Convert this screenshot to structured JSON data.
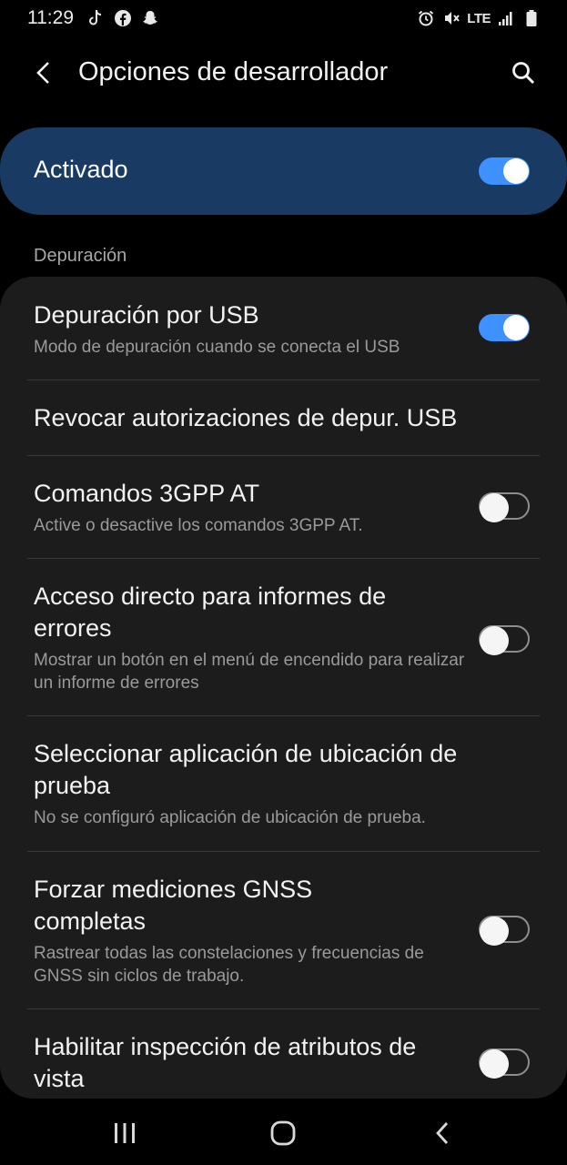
{
  "status_bar": {
    "time": "11:29",
    "network": "LTE",
    "left_icons": [
      "tiktok-icon",
      "facebook-icon",
      "snapchat-icon"
    ],
    "right_icons": [
      "alarm-icon",
      "mute-icon",
      "signal-icon",
      "battery-icon"
    ]
  },
  "header": {
    "title": "Opciones de desarrollador"
  },
  "master": {
    "label": "Activado",
    "enabled": true
  },
  "section": {
    "title": "Depuración"
  },
  "items": [
    {
      "title": "Depuración por USB",
      "subtitle": "Modo de depuración cuando se conecta el USB",
      "toggle": true
    },
    {
      "title": "Revocar autorizaciones de depur. USB"
    },
    {
      "title": "Comandos 3GPP AT",
      "subtitle": "Active o desactive los comandos 3GPP AT.",
      "toggle": false
    },
    {
      "title": "Acceso directo para informes de errores",
      "subtitle": "Mostrar un botón en el menú de encendido para realizar un informe de errores",
      "toggle": false
    },
    {
      "title": "Seleccionar aplicación de ubicación de prueba",
      "subtitle": "No se configuró aplicación de ubicación de prueba."
    },
    {
      "title": "Forzar mediciones GNSS completas",
      "subtitle": "Rastrear todas las constelaciones y frecuencias de GNSS sin ciclos de trabajo.",
      "toggle": false
    },
    {
      "title": "Habilitar inspección de atributos de vista",
      "toggle": false
    }
  ],
  "colors": {
    "accent": "#3e91ff",
    "master_bg": "#183a63",
    "card_bg": "#1c1c1c"
  }
}
